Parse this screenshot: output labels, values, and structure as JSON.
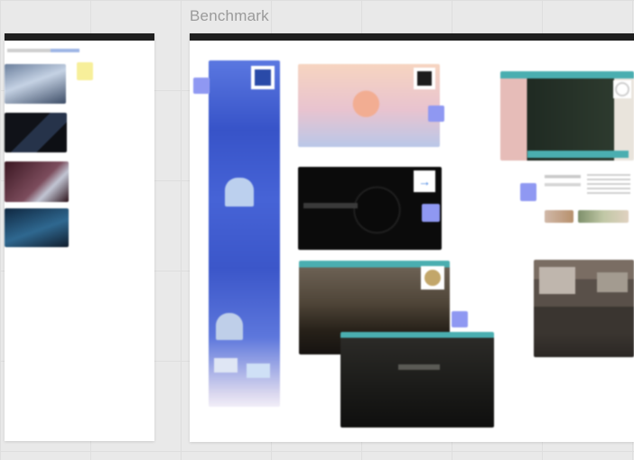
{
  "board": {
    "title": "Benchmark"
  },
  "colors": {
    "canvas": "#e9e9e9",
    "frame": "#ffffff",
    "frame_bar": "#1f1f1f",
    "sticky_yellow": "#f7ef9a",
    "sticky_blue": "#8f98f2",
    "teal_header": "#4aaeb0",
    "mobile_blue": "#3b5bd6"
  },
  "icons": {
    "arrow": "arrow-right-icon",
    "logo": "brand-logo-icon"
  }
}
